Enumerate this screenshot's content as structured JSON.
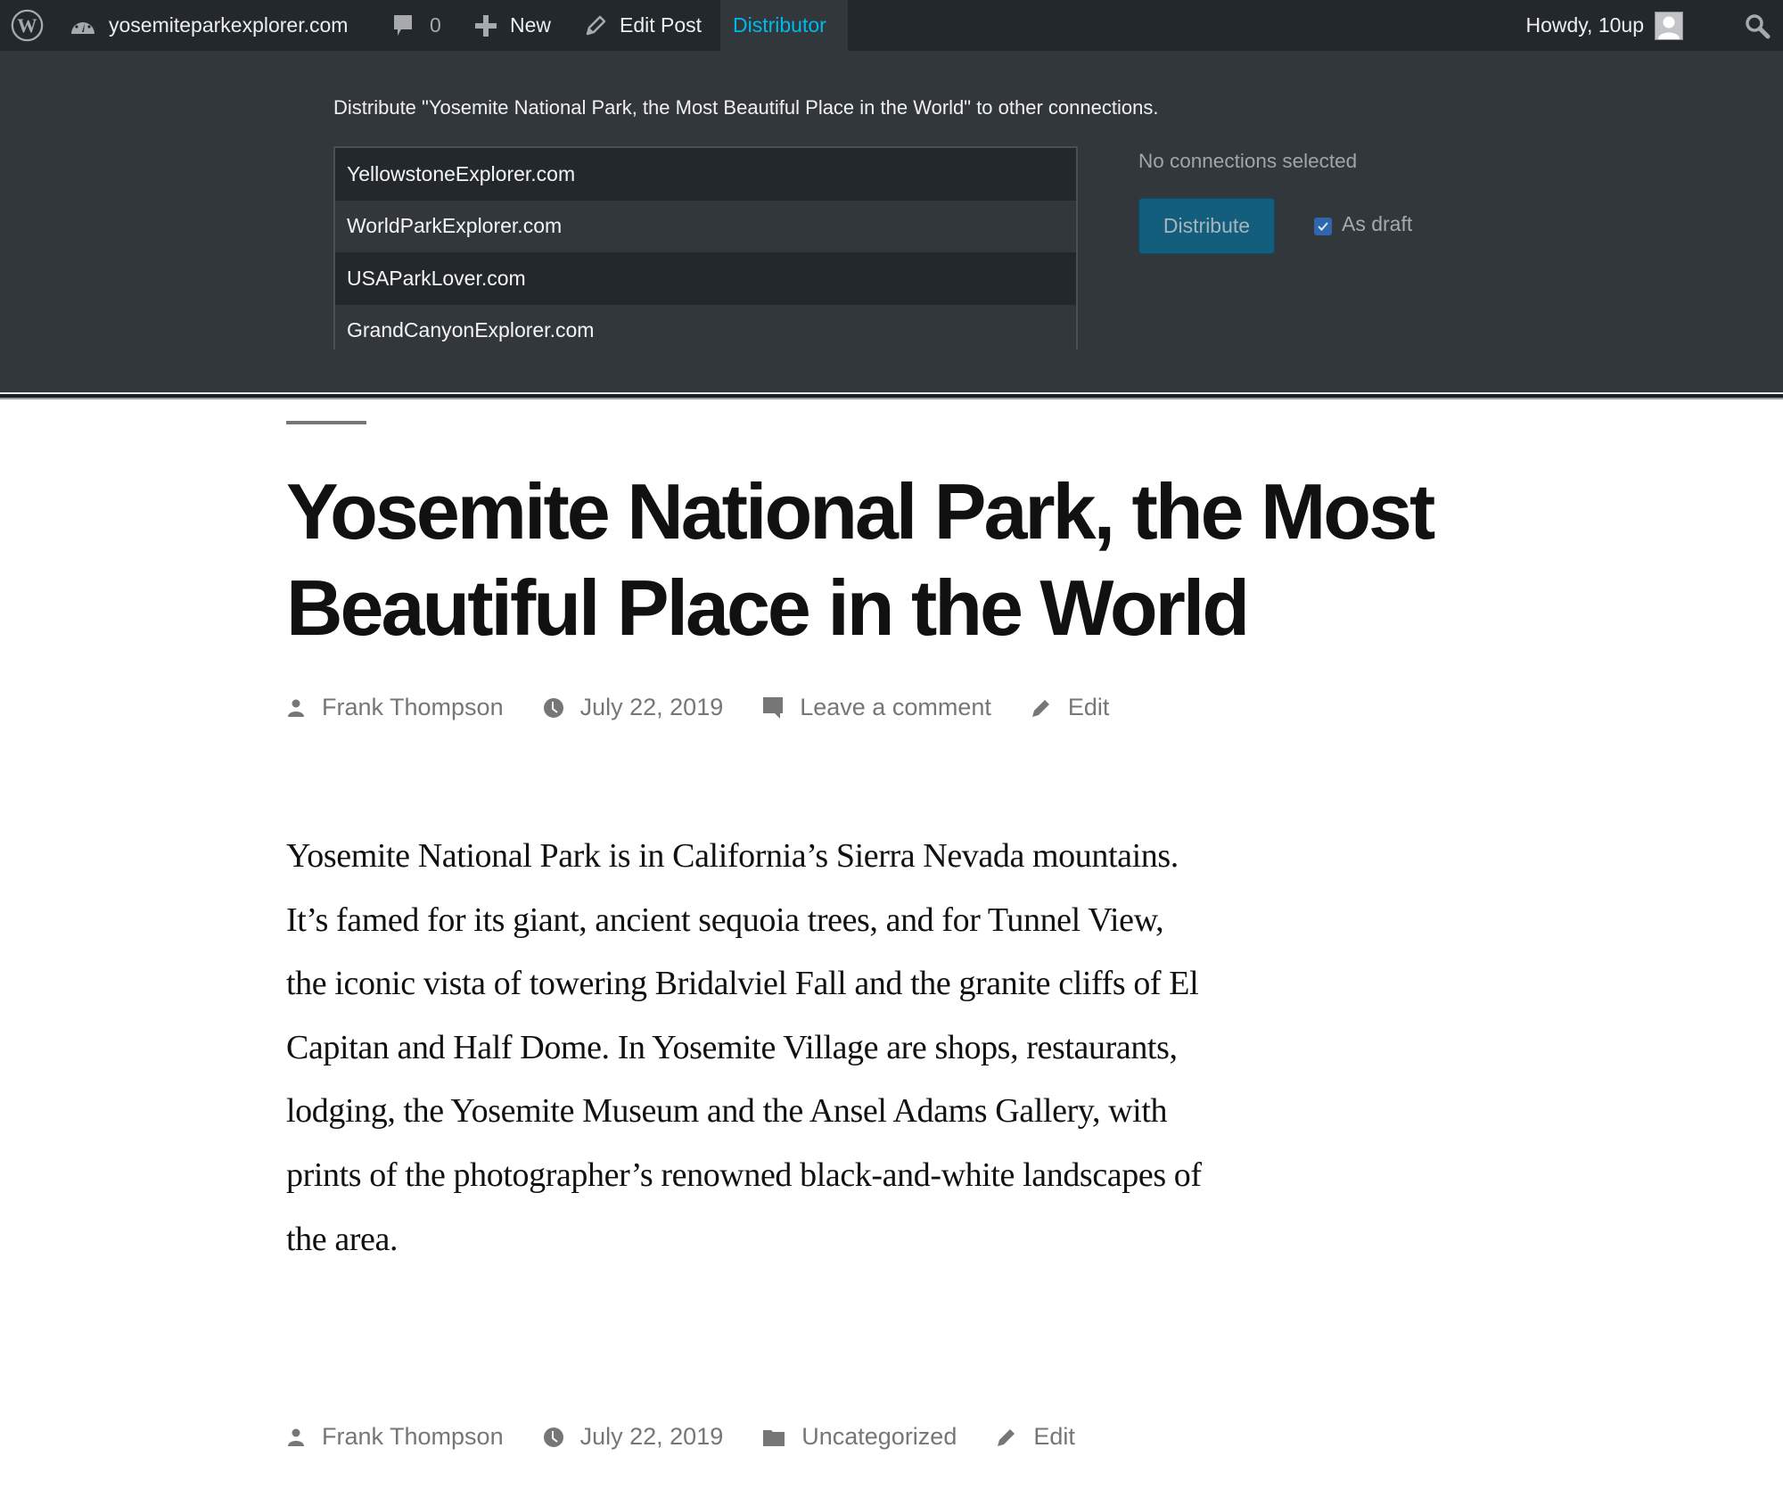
{
  "admin_bar": {
    "site_name": "yosemiteparkexplorer.com",
    "comments_count": "0",
    "new_label": "New",
    "edit_post_label": "Edit Post",
    "distributor_label": "Distributor",
    "howdy_label": "Howdy, 10up",
    "icons": {
      "logo": "wordpress-logo-icon",
      "dashboard": "dashboard-gauge-icon",
      "comments": "comment-bubble-icon",
      "new": "plus-icon",
      "edit": "pencil-icon",
      "avatar": "user-avatar-icon",
      "search": "search-icon"
    },
    "colors": {
      "background": "#23282d",
      "active_tab_text": "#00b9eb",
      "active_tab_bg": "#32373c"
    }
  },
  "distributor_panel": {
    "description": "Distribute \"Yosemite National Park, the Most Beautiful Place in the World\" to other connections.",
    "connections": [
      {
        "label": "YellowstoneExplorer.com"
      },
      {
        "label": "WorldParkExplorer.com"
      },
      {
        "label": "USAParkLover.com"
      },
      {
        "label": "GrandCanyonExplorer.com"
      }
    ],
    "selection_status": "No connections selected",
    "distribute_button": "Distribute",
    "as_draft_label": "As draft",
    "as_draft_checked": true,
    "colors": {
      "button_bg": "#135e7c",
      "checkbox": "#2e67ae"
    }
  },
  "post": {
    "title": "Yosemite National Park, the Most Beautiful Place in the World",
    "header_meta": {
      "author": "Frank Thompson",
      "date": "July 22, 2019",
      "comments": "Leave a comment",
      "edit": "Edit"
    },
    "body": "Yosemite National Park is in California’s Sierra Nevada mountains. It’s famed for its giant, ancient sequoia trees, and for Tunnel View, the iconic vista of towering Bridalviel Fall and the granite cliffs of El Capitan and Half Dome. In Yosemite Village are shops, restaurants, lodging, the Yosemite Museum and the Ansel Adams Gallery, with prints of the photographer’s renowned black-and-white landscapes of the area.",
    "footer_meta": {
      "author": "Frank Thompson",
      "date": "July 22, 2019",
      "category": "Uncategorized",
      "edit": "Edit"
    }
  }
}
